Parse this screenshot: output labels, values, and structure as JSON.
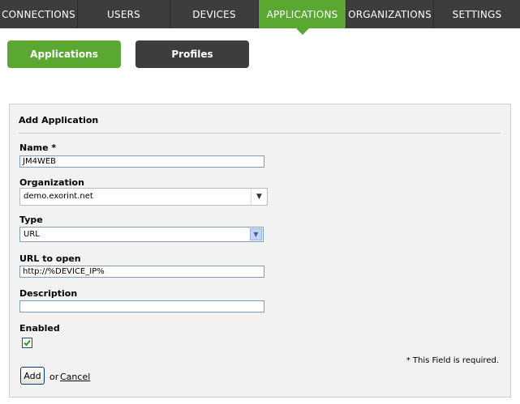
{
  "nav": {
    "tabs": [
      {
        "label": "CONNECTIONS",
        "active": false
      },
      {
        "label": "USERS",
        "active": false
      },
      {
        "label": "DEVICES",
        "active": false
      },
      {
        "label": "APPLICATIONS",
        "active": true
      },
      {
        "label": "ORGANIZATIONS",
        "active": false
      },
      {
        "label": "SETTINGS",
        "active": false
      }
    ]
  },
  "subnav": {
    "applications_label": "Applications",
    "profiles_label": "Profiles"
  },
  "form": {
    "title": "Add Application",
    "name_label": "Name *",
    "name_value": "JM4WEB",
    "organization_label": "Organization",
    "organization_value": "demo.exorint.net",
    "type_label": "Type",
    "type_value": "URL",
    "url_label": "URL to open",
    "url_value": "http://%DEVICE_IP%",
    "description_label": "Description",
    "description_value": "",
    "enabled_label": "Enabled",
    "enabled_checked": true,
    "required_note": "* This Field is required.",
    "add_label": "Add",
    "or_text": "or",
    "cancel_label": "Cancel"
  },
  "colors": {
    "accent": "#5aa832",
    "nav_bg": "#3d3d3d",
    "panel_bg": "#f2f2f2"
  },
  "icons": {
    "dropdown": "chevron-down-icon",
    "check": "checkmark-icon"
  }
}
